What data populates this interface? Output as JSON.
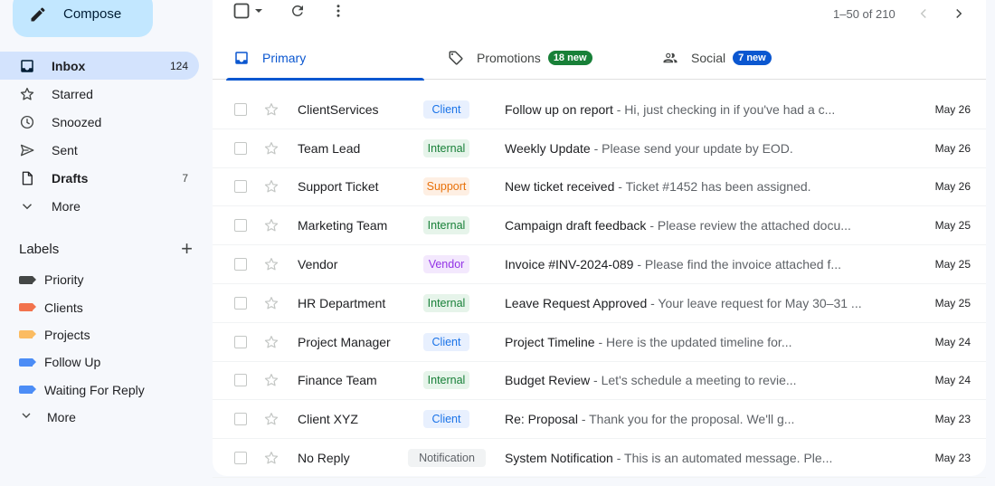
{
  "compose": {
    "label": "Compose"
  },
  "nav": [
    {
      "name": "nav-inbox",
      "icon": "inbox-icon",
      "label": "Inbox",
      "count": "124",
      "active": true
    },
    {
      "name": "nav-starred",
      "icon": "star-icon",
      "label": "Starred",
      "count": ""
    },
    {
      "name": "nav-snoozed",
      "icon": "clock-icon",
      "label": "Snoozed",
      "count": ""
    },
    {
      "name": "nav-sent",
      "icon": "send-icon",
      "label": "Sent",
      "count": ""
    },
    {
      "name": "nav-drafts",
      "icon": "draft-icon",
      "label": "Drafts",
      "count": "7",
      "bold": true
    },
    {
      "name": "nav-more",
      "icon": "chevron-down-icon",
      "label": "More",
      "count": ""
    }
  ],
  "labels": {
    "title": "Labels",
    "add": "+",
    "items": [
      {
        "label": "Priority",
        "color": "#444746"
      },
      {
        "label": "Clients",
        "color": "#f2734d"
      },
      {
        "label": "Projects",
        "color": "#fbbc62"
      },
      {
        "label": "Follow Up",
        "color": "#4c8df6"
      },
      {
        "label": "Waiting For Reply",
        "color": "#4c8df6"
      }
    ],
    "more": "More"
  },
  "toolbar": {
    "pager": "1–50 of 210"
  },
  "tabs": [
    {
      "label": "Primary",
      "badge": "",
      "active": true
    },
    {
      "label": "Promotions",
      "badge": "18 new",
      "badge_color": "#188038"
    },
    {
      "label": "Social",
      "badge": "7 new",
      "badge_color": "#0b57d0"
    }
  ],
  "label_styles": {
    "Client": {
      "bg": "#e8f0fe",
      "fg": "#1a73e8"
    },
    "Internal": {
      "bg": "#e6f4ea",
      "fg": "#188038"
    },
    "Support": {
      "bg": "#feefe3",
      "fg": "#e8710a"
    },
    "Vendor": {
      "bg": "#f3e8fd",
      "fg": "#9334e6"
    },
    "Notification": {
      "bg": "#f1f3f4",
      "fg": "#5f6368"
    }
  },
  "emails": [
    {
      "sender": "ClientServices",
      "label": "Client",
      "subject": "Follow up on report",
      "snippet": " - Hi, just checking in if you've had a c...",
      "date": "May 26"
    },
    {
      "sender": "Team Lead",
      "label": "Internal",
      "subject": "Weekly Update",
      "snippet": " - Please send your update by EOD.",
      "date": "May 26"
    },
    {
      "sender": "Support Ticket",
      "label": "Support",
      "subject": "New ticket received",
      "snippet": " - Ticket #1452 has been assigned.",
      "date": "May 26"
    },
    {
      "sender": "Marketing Team",
      "label": "Internal",
      "subject": "Campaign draft feedback",
      "snippet": " - Please review the attached docu...",
      "date": "May 25"
    },
    {
      "sender": "Vendor",
      "label": "Vendor",
      "subject": "Invoice #INV-2024-089",
      "snippet": " - Please find the invoice attached f...",
      "date": "May 25"
    },
    {
      "sender": "HR Department",
      "label": "Internal",
      "subject": "Leave Request Approved",
      "snippet": " - Your leave request for May 30–31 ...",
      "date": "May 25"
    },
    {
      "sender": "Project Manager",
      "label": "Client",
      "subject": "Project Timeline",
      "snippet": " - Here is the updated timeline for...",
      "date": "May 24"
    },
    {
      "sender": "Finance Team",
      "label": "Internal",
      "subject": "Budget Review",
      "snippet": " - Let's schedule a meeting to revie...",
      "date": "May 24"
    },
    {
      "sender": "Client XYZ",
      "label": "Client",
      "subject": "Re: Proposal",
      "snippet": " - Thank you for the proposal. We'll g...",
      "date": "May 23"
    },
    {
      "sender": "No Reply",
      "label": "Notification",
      "subject": "System Notification",
      "snippet": " - This is an automated message. Ple...",
      "date": "May 23"
    }
  ]
}
